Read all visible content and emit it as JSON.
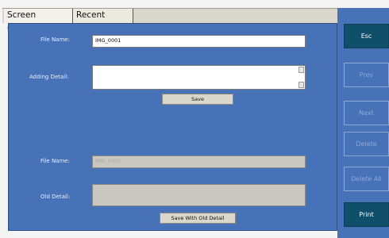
{
  "tabs": [
    {
      "label": "Screen Capture"
    },
    {
      "label": "Recent Images"
    }
  ],
  "form": {
    "file_name_label": "File Name:",
    "file_name_value": "IMG_0001",
    "adding_detail_label": "Adding Detail:",
    "adding_detail_value": "",
    "save_label": "Save",
    "old_file_name_label": "File Name:",
    "old_file_name_value": "IMG_0001",
    "old_detail_label": "Old Detail:",
    "old_detail_value": "",
    "save_with_old_label": "Save With Old Detail"
  },
  "side": {
    "esc": "Esc",
    "prev": "Prev",
    "next": "Next",
    "delete": "Delete",
    "delete_all": "Delete All",
    "print": "Print"
  },
  "colors": {
    "panel": "#4872b8",
    "active_button": "#0f4f6a"
  }
}
